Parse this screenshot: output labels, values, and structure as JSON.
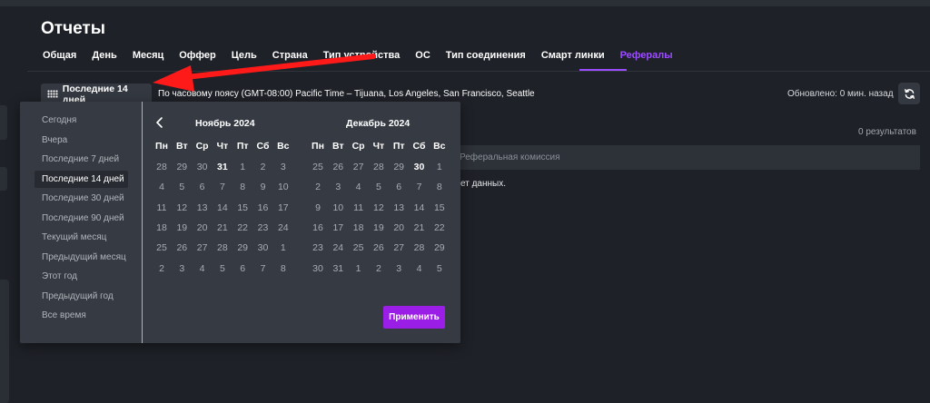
{
  "page": {
    "title": "Отчеты"
  },
  "tabs": [
    {
      "label": "Общая"
    },
    {
      "label": "День"
    },
    {
      "label": "Месяц"
    },
    {
      "label": "Оффер"
    },
    {
      "label": "Цель"
    },
    {
      "label": "Страна"
    },
    {
      "label": "Тип устройства"
    },
    {
      "label": "ОС"
    },
    {
      "label": "Тип соединения"
    },
    {
      "label": "Смарт линки"
    },
    {
      "label": "Рефералы"
    }
  ],
  "active_tab": "Рефералы",
  "filter": {
    "range_label": "Последние 14 дней",
    "timezone_text": "По часовому поясу (GMT-08:00) Pacific Time – Tijuana, Los Angeles, San Francisco, Seattle",
    "updated_text": "Обновлено: 0 мин. назад"
  },
  "results": {
    "count_text": "0  результатов",
    "column_header": "Реферальная комиссия",
    "empty_text": "ет данных."
  },
  "picker": {
    "presets": [
      {
        "label": "Сегодня"
      },
      {
        "label": "Вчера"
      },
      {
        "label": "Последние 7 дней"
      },
      {
        "label": "Последние 14 дней"
      },
      {
        "label": "Последние 30 дней"
      },
      {
        "label": "Последние 90 дней"
      },
      {
        "label": "Текущий месяц"
      },
      {
        "label": "Предыдущий месяц"
      },
      {
        "label": "Этот год"
      },
      {
        "label": "Предыдущий год"
      },
      {
        "label": "Все время"
      }
    ],
    "selected_preset": "Последние 14 дней",
    "weekdays": [
      "Пн",
      "Вт",
      "Ср",
      "Чт",
      "Пт",
      "Сб",
      "Вс"
    ],
    "months": [
      {
        "title": "Ноябрь 2024",
        "weeks": [
          [
            "28",
            "29",
            "30",
            "31",
            "1",
            "2",
            "3"
          ],
          [
            "4",
            "5",
            "6",
            "7",
            "8",
            "9",
            "10"
          ],
          [
            "11",
            "12",
            "13",
            "14",
            "15",
            "16",
            "17"
          ],
          [
            "18",
            "19",
            "20",
            "21",
            "22",
            "23",
            "24"
          ],
          [
            "25",
            "26",
            "27",
            "28",
            "29",
            "30",
            "1"
          ],
          [
            "2",
            "3",
            "4",
            "5",
            "6",
            "7",
            "8"
          ]
        ],
        "first_in_month": 4,
        "days_in_month": 30
      },
      {
        "title": "Декабрь 2024",
        "weeks": [
          [
            "25",
            "26",
            "27",
            "28",
            "29",
            "30",
            "1"
          ],
          [
            "2",
            "3",
            "4",
            "5",
            "6",
            "7",
            "8"
          ],
          [
            "9",
            "10",
            "11",
            "12",
            "13",
            "14",
            "15"
          ],
          [
            "16",
            "17",
            "18",
            "19",
            "20",
            "21",
            "22"
          ],
          [
            "23",
            "24",
            "25",
            "26",
            "27",
            "28",
            "29"
          ],
          [
            "30",
            "31",
            "1",
            "2",
            "3",
            "4",
            "5"
          ]
        ],
        "first_in_month": 6,
        "days_in_month": 31,
        "range_start": 14,
        "range_end": 27
      }
    ],
    "apply_label": "Применить"
  },
  "colors": {
    "accent": "#9b1ee6",
    "active_tab": "#9b4dff",
    "annotation_arrow": "#ff1a1a"
  }
}
